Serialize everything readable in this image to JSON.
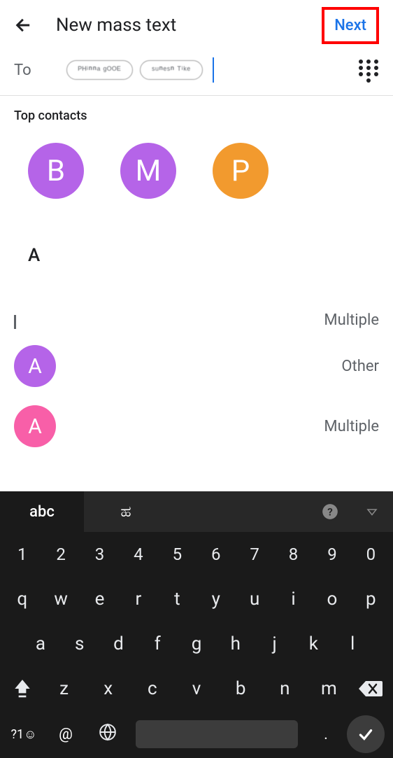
{
  "header": {
    "title": "New mass text",
    "next_label": "Next"
  },
  "to": {
    "label": "To",
    "chips": [
      "ᴾᴴⁱⁿⁿᵃ ᵍᴼᴼᴱ",
      "ˢᵘⁿᵉˢⁿ ᵀⁱᵏᵉ"
    ]
  },
  "top_contacts": {
    "label": "Top contacts",
    "items": [
      {
        "letter": "B",
        "color": "purple"
      },
      {
        "letter": "M",
        "color": "purple"
      },
      {
        "letter": "P",
        "color": "orange"
      }
    ]
  },
  "section_letter": "A",
  "contacts": [
    {
      "avatar": "",
      "type": "Multiple",
      "color": ""
    },
    {
      "avatar": "A",
      "type": "Other",
      "color": "purple"
    },
    {
      "avatar": "A",
      "type": "Multiple",
      "color": "pink"
    }
  ],
  "keyboard": {
    "tab1": "abc",
    "tab2": "ಹ",
    "numbers": [
      "1",
      "2",
      "3",
      "4",
      "5",
      "6",
      "7",
      "8",
      "9",
      "0"
    ],
    "row_q": [
      "q",
      "w",
      "e",
      "r",
      "t",
      "y",
      "u",
      "i",
      "o",
      "p"
    ],
    "row_a": [
      "a",
      "s",
      "d",
      "f",
      "g",
      "h",
      "j",
      "k",
      "l"
    ],
    "row_z": [
      "z",
      "x",
      "c",
      "v",
      "b",
      "n",
      "m"
    ],
    "sym": "?1☺",
    "at": "@",
    "dot": "."
  }
}
